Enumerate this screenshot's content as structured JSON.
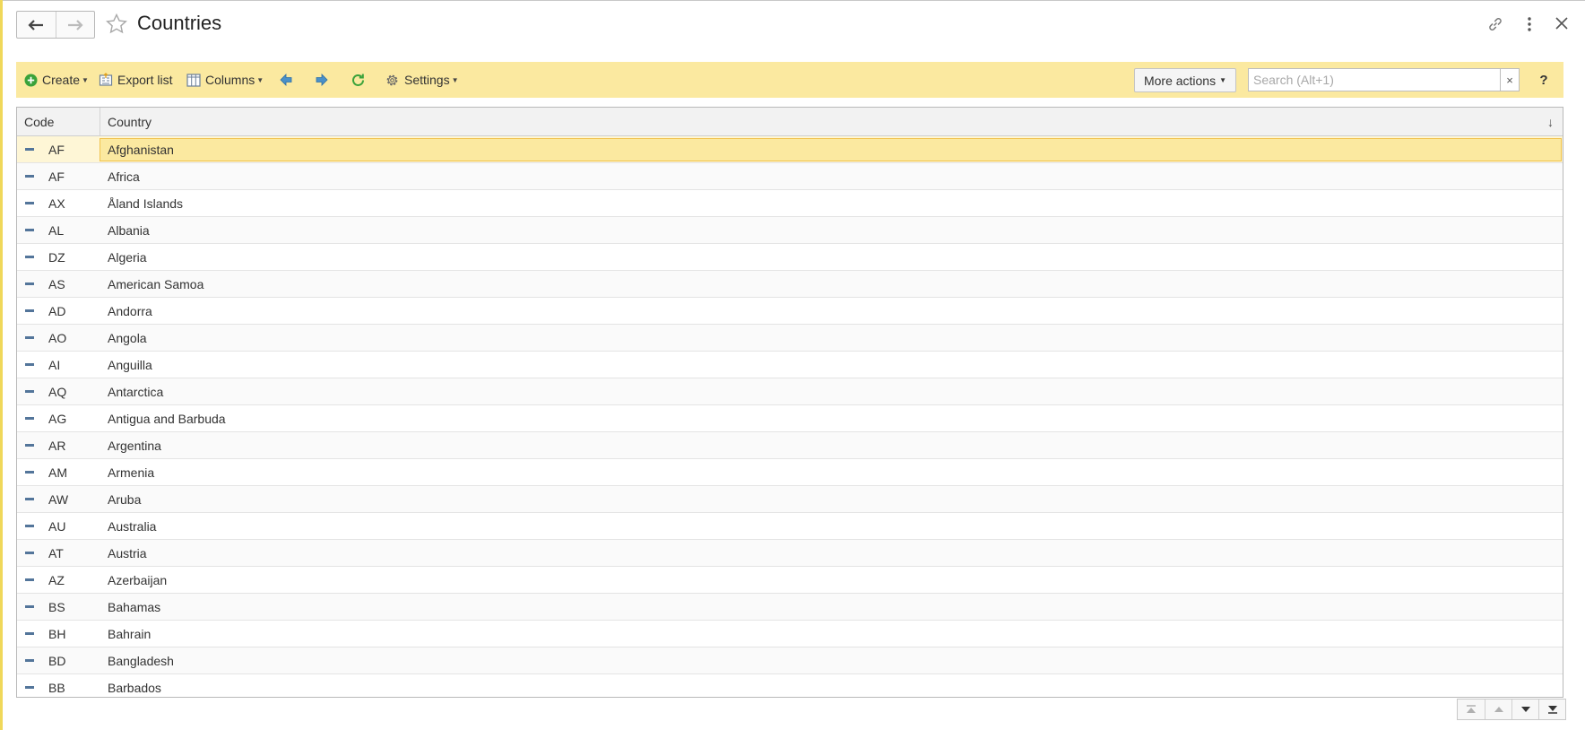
{
  "page": {
    "title": "Countries"
  },
  "toolbar": {
    "create_label": "Create",
    "export_label": "Export list",
    "columns_label": "Columns",
    "settings_label": "Settings",
    "more_actions_label": "More actions",
    "search_placeholder": "Search (Alt+1)",
    "search_value": "",
    "clear_label": "×",
    "help_label": "?"
  },
  "colors": {
    "toolbar_bg": "#fbe9a0",
    "selected_cell_bg": "#fbe9a0",
    "create_icon": "#3aa23a",
    "refresh_icon": "#3aa23a",
    "nav_arrow_icon": "#4a90c8",
    "row_marker": "#53759a"
  },
  "icons": {
    "back": "arrow-left-icon",
    "forward": "arrow-right-icon",
    "favorite": "star-icon",
    "link": "link-icon",
    "more": "vertical-dots-icon",
    "close": "close-icon",
    "create": "plus-circle-icon",
    "export": "export-icon",
    "columns": "columns-icon",
    "prev": "left-nav-icon",
    "next": "right-nav-icon",
    "refresh": "refresh-icon",
    "settings": "gear-icon"
  },
  "grid": {
    "columns": {
      "code": "Code",
      "country": "Country"
    },
    "sort_indicator": "↓",
    "rows": [
      {
        "code": "AF",
        "country": "Afghanistan"
      },
      {
        "code": "AF",
        "country": "Africa"
      },
      {
        "code": "AX",
        "country": "Åland Islands"
      },
      {
        "code": "AL",
        "country": "Albania"
      },
      {
        "code": "DZ",
        "country": "Algeria"
      },
      {
        "code": "AS",
        "country": "American Samoa"
      },
      {
        "code": "AD",
        "country": "Andorra"
      },
      {
        "code": "AO",
        "country": "Angola"
      },
      {
        "code": "AI",
        "country": "Anguilla"
      },
      {
        "code": "AQ",
        "country": "Antarctica"
      },
      {
        "code": "AG",
        "country": "Antigua and Barbuda"
      },
      {
        "code": "AR",
        "country": "Argentina"
      },
      {
        "code": "AM",
        "country": "Armenia"
      },
      {
        "code": "AW",
        "country": "Aruba"
      },
      {
        "code": "AU",
        "country": "Australia"
      },
      {
        "code": "AT",
        "country": "Austria"
      },
      {
        "code": "AZ",
        "country": "Azerbaijan"
      },
      {
        "code": "BS",
        "country": "Bahamas"
      },
      {
        "code": "BH",
        "country": "Bahrain"
      },
      {
        "code": "BD",
        "country": "Bangladesh"
      },
      {
        "code": "BB",
        "country": "Barbados"
      }
    ]
  }
}
